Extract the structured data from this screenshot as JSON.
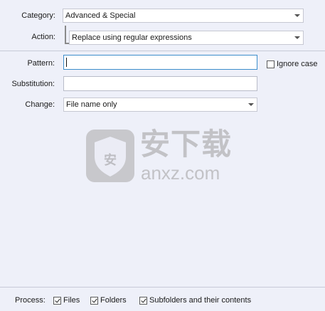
{
  "category": {
    "label": "Category:",
    "value": "Advanced & Special"
  },
  "action": {
    "label": "Action:",
    "value": "Replace using regular expressions"
  },
  "pattern": {
    "label": "Pattern:",
    "value": ""
  },
  "ignore_case": {
    "label": "Ignore case",
    "checked": false
  },
  "substitution": {
    "label": "Substitution:",
    "value": ""
  },
  "change": {
    "label": "Change:",
    "value": "File name only"
  },
  "process": {
    "label": "Process:",
    "files": {
      "label": "Files",
      "checked": true
    },
    "folders": {
      "label": "Folders",
      "checked": true
    },
    "subfolders": {
      "label": "Subfolders and their contents",
      "checked": true
    }
  },
  "watermark": {
    "cn_text": "安下载",
    "url_text": "anxz.com",
    "shield_char": "安"
  }
}
